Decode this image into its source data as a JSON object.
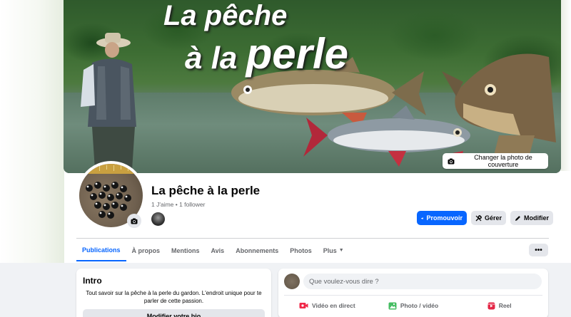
{
  "cover": {
    "title_line1": "La pêche",
    "title_line2_a": "à la ",
    "title_line2_b": "perle",
    "change_cover_label": "Changer la photo de couverture"
  },
  "profile": {
    "name": "La pêche à la perle",
    "stats": "1 J'aime • 1 follower"
  },
  "actions": {
    "promote_label": "Promouvoir",
    "manage_label": "Gérer",
    "edit_label": "Modifier"
  },
  "tabs": [
    {
      "label": "Publications",
      "active": true
    },
    {
      "label": "À propos"
    },
    {
      "label": "Mentions"
    },
    {
      "label": "Avis"
    },
    {
      "label": "Abonnements"
    },
    {
      "label": "Photos"
    },
    {
      "label": "Plus"
    }
  ],
  "more_menu_label": "•••",
  "intro": {
    "title": "Intro",
    "text": "Tout savoir sur la pêche à la perle du gardon. L'endroit unique pour te parler de cette passion.",
    "edit_bio_label": "Modifier votre bio"
  },
  "composer": {
    "placeholder": "Que voulez-vous dire ?",
    "live_label": "Vidéo en direct",
    "photo_label": "Photo / vidéo",
    "reel_label": "Reel"
  },
  "colors": {
    "accent": "#0866ff",
    "live_icon": "#f02849",
    "photo_icon": "#45bd62",
    "reel_icon": "#e42645"
  }
}
